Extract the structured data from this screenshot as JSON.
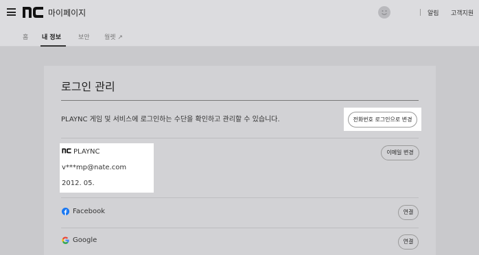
{
  "header": {
    "title": "마이페이지",
    "alarm": "알림",
    "support": "고객지원"
  },
  "tabs": [
    {
      "label": "홈"
    },
    {
      "label": "내 정보"
    },
    {
      "label": "보안"
    },
    {
      "label": "월렛 ↗"
    }
  ],
  "card": {
    "title": "로그인 관리",
    "description": "PLAYNC 게임 및 서비스에 로그인하는 수단을 확인하고 관리할 수 있습니다.",
    "phone_login_button": "전화번호 로그인으로 변경",
    "account": {
      "provider": "PLAYNC",
      "email": "v***mp@nate.com",
      "date": "2012. 05."
    },
    "email_change_button": "이메일 변경",
    "socials": [
      {
        "name": "Facebook",
        "button": "연결"
      },
      {
        "name": "Google",
        "button": "연결"
      }
    ]
  },
  "colors": {
    "facebook": "#1877f2",
    "google_red": "#ea4335",
    "google_blue": "#4285f4",
    "google_yellow": "#fbbc05",
    "google_green": "#34a853"
  }
}
